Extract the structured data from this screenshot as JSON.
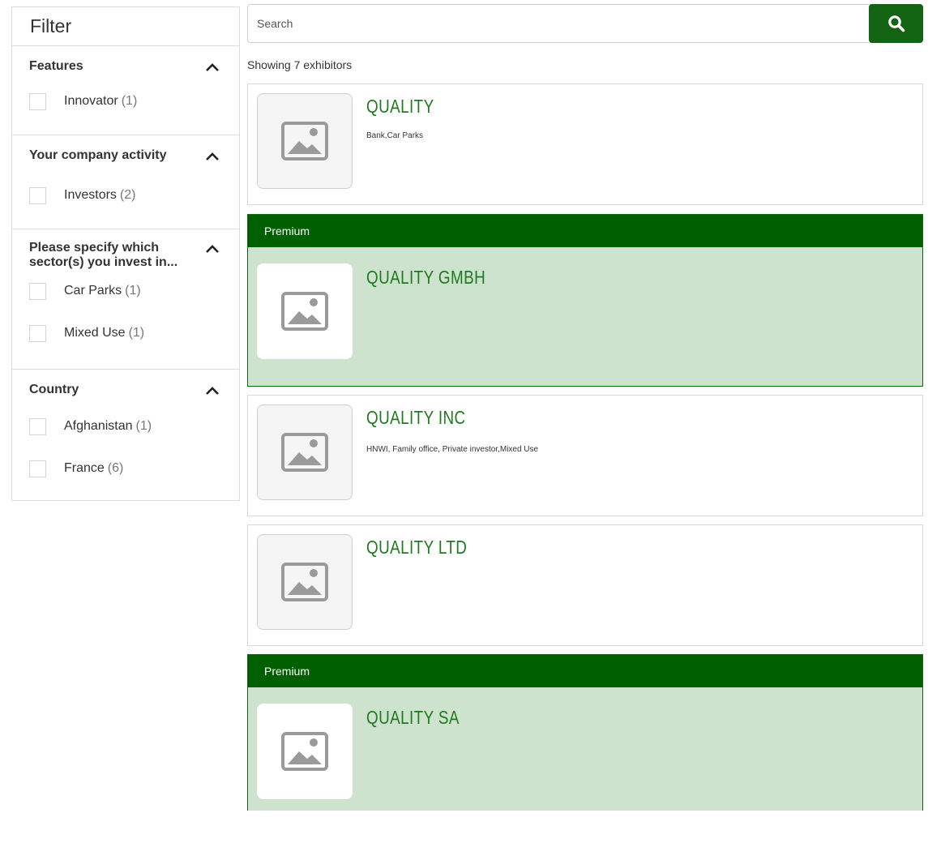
{
  "sidebar": {
    "title": "Filter",
    "groups": [
      {
        "label": "Features",
        "options": [
          {
            "label": "Innovator",
            "count": "(1)"
          }
        ]
      },
      {
        "label": "Your company activity",
        "options": [
          {
            "label": "Investors",
            "count": "(2)"
          }
        ]
      },
      {
        "label_line1": "Please specify which",
        "label_line2": "sector(s) you invest in...",
        "options": [
          {
            "label": "Car Parks",
            "count": "(1)"
          },
          {
            "label": "Mixed Use",
            "count": "(1)"
          }
        ]
      },
      {
        "label": "Country",
        "options": [
          {
            "label": "Afghanistan",
            "count": "(1)"
          },
          {
            "label": "France",
            "count": "(6)"
          }
        ]
      }
    ]
  },
  "search": {
    "placeholder": "Search",
    "value": ""
  },
  "results": {
    "summary": "Showing 7 exhibitors"
  },
  "exhibitors": [
    {
      "name": "QUALITY",
      "tags": "Bank,Car Parks",
      "premium": false
    },
    {
      "name": "QUALITY GMBH",
      "tags": "",
      "premium": true,
      "badge": "Premium"
    },
    {
      "name": "QUALITY INC",
      "tags": "HNWI, Family office, Private investor,Mixed Use",
      "premium": false
    },
    {
      "name": "QUALITY LTD",
      "tags": "",
      "premium": false
    },
    {
      "name": "QUALITY SA",
      "tags": "",
      "premium": true,
      "badge": "Premium"
    }
  ],
  "icons": {
    "search_button": "search-icon",
    "group_toggle": "chevron-up-icon",
    "logo_placeholder": "image-placeholder-icon"
  },
  "colors": {
    "brand_green": "#006000",
    "title_green": "#1f7a1f",
    "premium_background": "#cde3cd"
  }
}
